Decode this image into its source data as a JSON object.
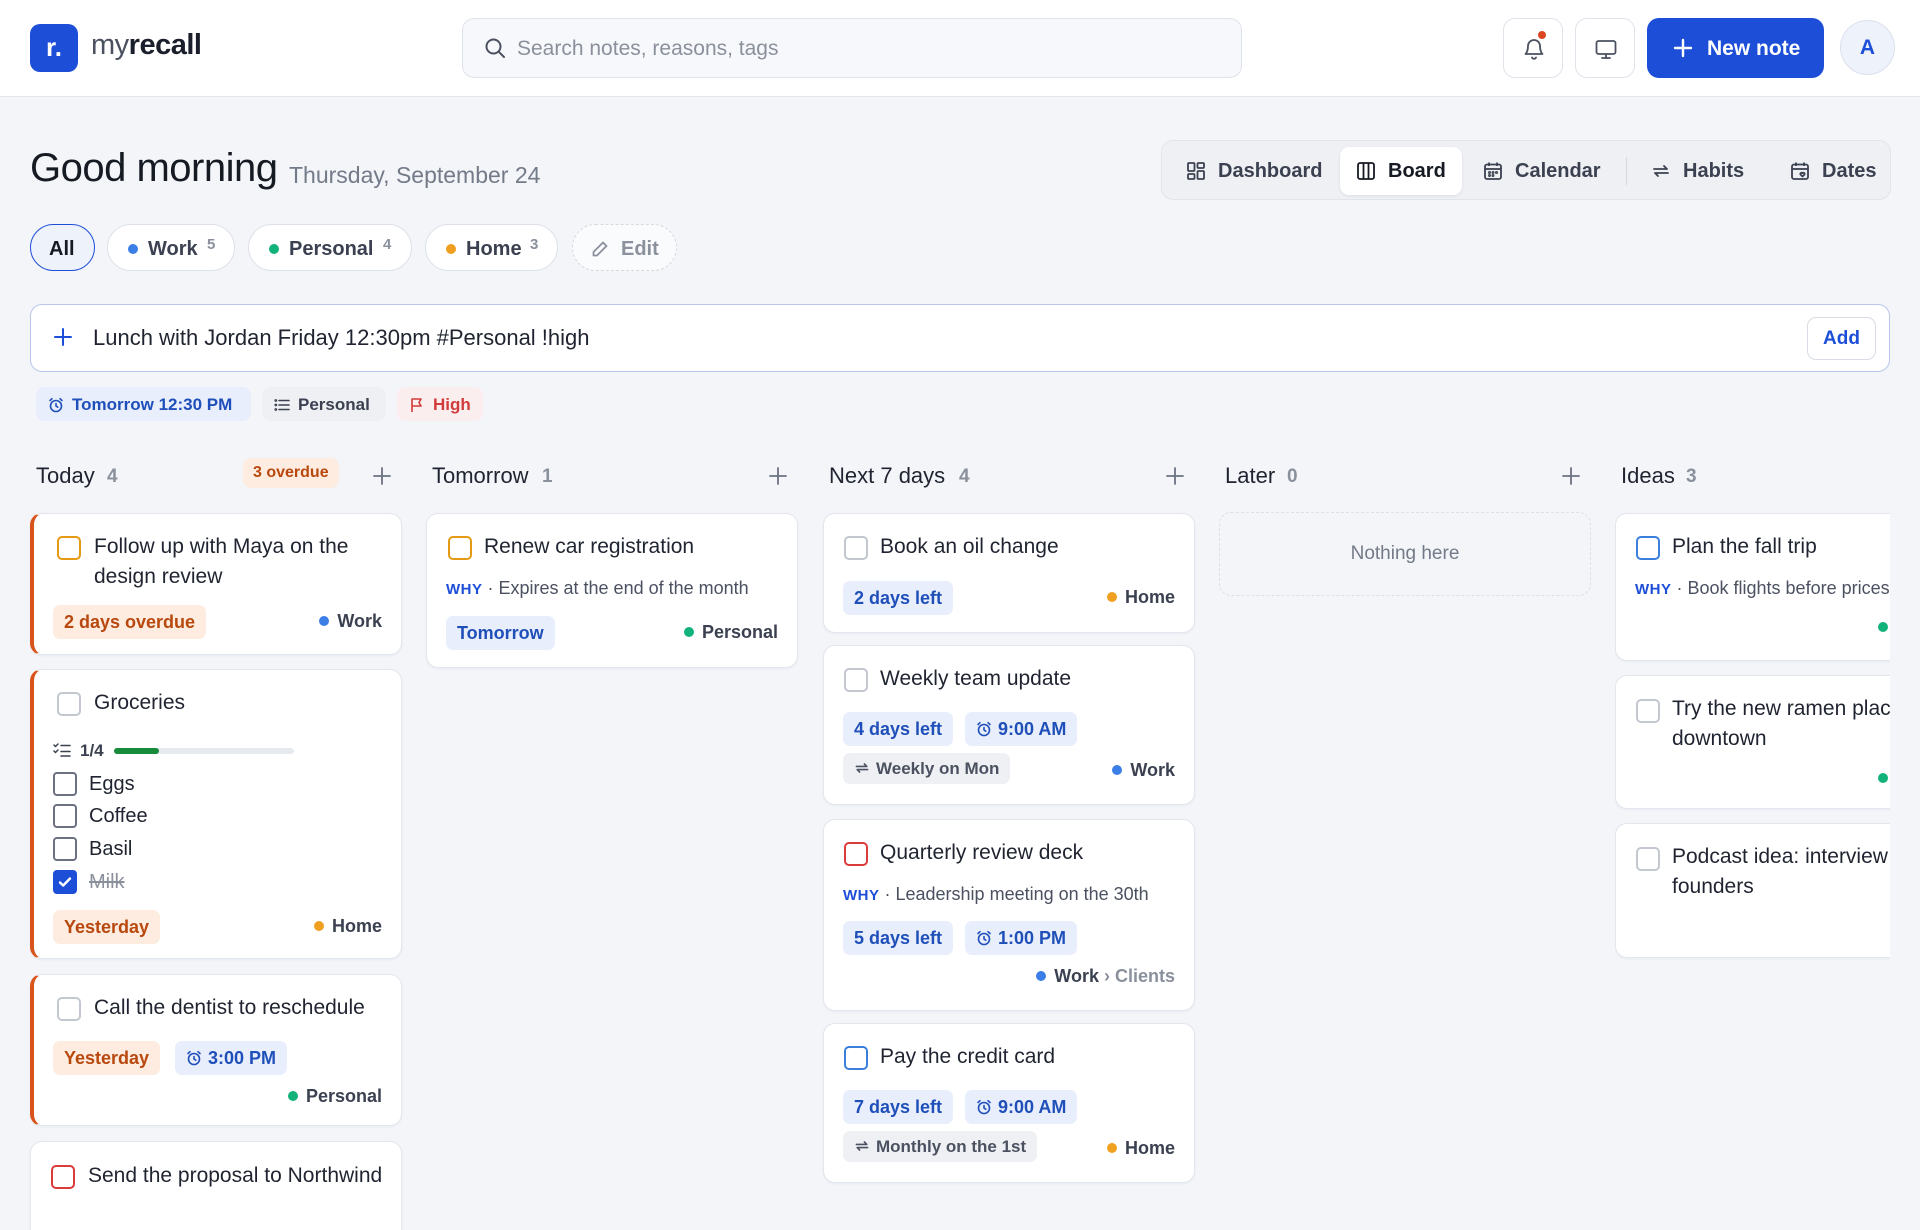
{
  "header": {
    "logo_mark": "r.",
    "logo_light": "my",
    "logo_bold": "recall",
    "search_placeholder": "Search notes, reasons, tags",
    "new_note_label": "New note",
    "avatar_initial": "A"
  },
  "greeting": {
    "title": "Good morning",
    "date": "Thursday, September 24"
  },
  "views": [
    {
      "label": "Dashboard",
      "icon": "dashboard-icon",
      "active": false
    },
    {
      "label": "Board",
      "icon": "board-icon",
      "active": true
    },
    {
      "label": "Calendar",
      "icon": "calendar-icon",
      "active": false
    },
    {
      "label": "Habits",
      "icon": "repeat-icon",
      "active": false
    },
    {
      "label": "Dates",
      "icon": "calendar-heart-icon",
      "active": false
    }
  ],
  "filters": [
    {
      "label": "All",
      "count": null,
      "active": true
    },
    {
      "label": "Work",
      "count": "5",
      "color": "#3b7fe6"
    },
    {
      "label": "Personal",
      "count": "4",
      "color": "#12b37a"
    },
    {
      "label": "Home",
      "count": "3",
      "color": "#f0a020"
    },
    {
      "label": "Edit",
      "icon": "pencil-icon"
    }
  ],
  "quick_add": {
    "value": "Lunch with Jordan Friday 12:30pm #Personal !high",
    "add_label": "Add",
    "hints": {
      "time": "Tomorrow 12:30 PM",
      "list": "Personal",
      "priority": "High"
    }
  },
  "colors": {
    "accent": "#1d4ed8",
    "work": "#3b7fe6",
    "personal": "#12b37a",
    "home": "#f0a020",
    "overdue": "#d9541b"
  },
  "columns": [
    {
      "title": "Today",
      "count": "4",
      "badge": "3 overdue",
      "cards": [
        {
          "title": "Follow up with Maya on the design review",
          "date": "2 days overdue",
          "tag": "Work"
        },
        {
          "title": "Groceries",
          "progress_text": "1/4",
          "progress": 0.25,
          "subtasks": [
            {
              "text": "Eggs",
              "done": false
            },
            {
              "text": "Coffee",
              "done": false
            },
            {
              "text": "Basil",
              "done": false
            },
            {
              "text": "Milk",
              "done": true
            }
          ],
          "date": "Yesterday",
          "tag": "Home"
        },
        {
          "title": "Call the dentist to reschedule",
          "date": "Yesterday",
          "time": "3:00 PM",
          "tag": "Personal"
        },
        {
          "title": "Send the proposal to Northwind"
        }
      ]
    },
    {
      "title": "Tomorrow",
      "count": "1",
      "cards": [
        {
          "title": "Renew car registration",
          "why_label": "WHY",
          "why": "Expires at the end of the month",
          "date": "Tomorrow",
          "tag": "Personal"
        }
      ]
    },
    {
      "title": "Next 7 days",
      "count": "4",
      "cards": [
        {
          "title": "Book an oil change",
          "date": "2 days left",
          "tag": "Home"
        },
        {
          "title": "Weekly team update",
          "date": "4 days left",
          "time": "9:00 AM",
          "repeat": "Weekly on Mon",
          "tag": "Work"
        },
        {
          "title": "Quarterly review deck",
          "why_label": "WHY",
          "why": "Leadership meeting on the 30th",
          "date": "5 days left",
          "time": "1:00 PM",
          "tag": "Work",
          "tag_sub": "› Clients"
        },
        {
          "title": "Pay the credit card",
          "date": "7 days left",
          "time": "9:00 AM",
          "repeat": "Monthly on the 1st",
          "tag": "Home"
        }
      ]
    },
    {
      "title": "Later",
      "count": "0",
      "empty_text": "Nothing here",
      "cards": []
    },
    {
      "title": "Ideas",
      "count": "3",
      "cards": [
        {
          "title": "Plan the fall trip",
          "why_label": "WHY",
          "why": "Book flights before prices go up"
        },
        {
          "title": "Try the new ramen place downtown"
        },
        {
          "title": "Podcast idea: interview local founders"
        }
      ]
    }
  ]
}
